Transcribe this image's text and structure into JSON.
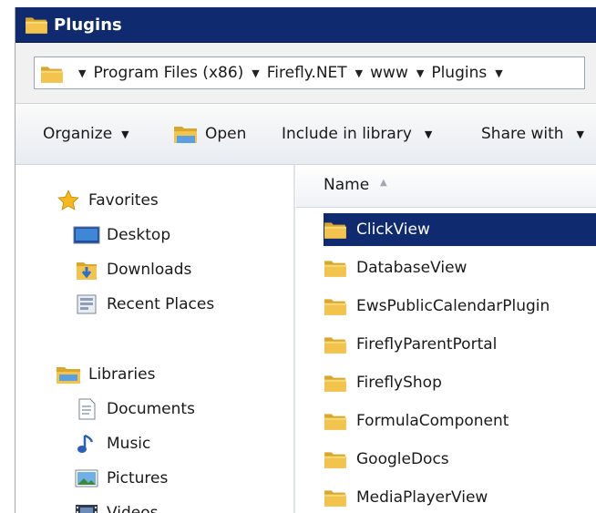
{
  "window": {
    "title": "Plugins"
  },
  "address": {
    "crumbs": [
      "Program Files (x86)",
      "Firefly.NET",
      "www",
      "Plugins"
    ]
  },
  "toolbar": {
    "organize": "Organize",
    "open": "Open",
    "include_in_library": "Include in library",
    "share_with": "Share with"
  },
  "nav": {
    "favorites": "Favorites",
    "desktop": "Desktop",
    "downloads": "Downloads",
    "recent_places": "Recent Places",
    "libraries": "Libraries",
    "documents": "Documents",
    "music": "Music",
    "pictures": "Pictures",
    "videos": "Videos"
  },
  "columns": {
    "name": "Name"
  },
  "files": [
    "ClickView",
    "DatabaseView",
    "EwsPublicCalendarPlugin",
    "FireflyParentPortal",
    "FireflyShop",
    "FormulaComponent",
    "GoogleDocs",
    "MediaPlayerView"
  ],
  "colors": {
    "titlebar": "#0f2a6e",
    "selection": "#0f2a6e",
    "folder": "#f2c44e"
  }
}
